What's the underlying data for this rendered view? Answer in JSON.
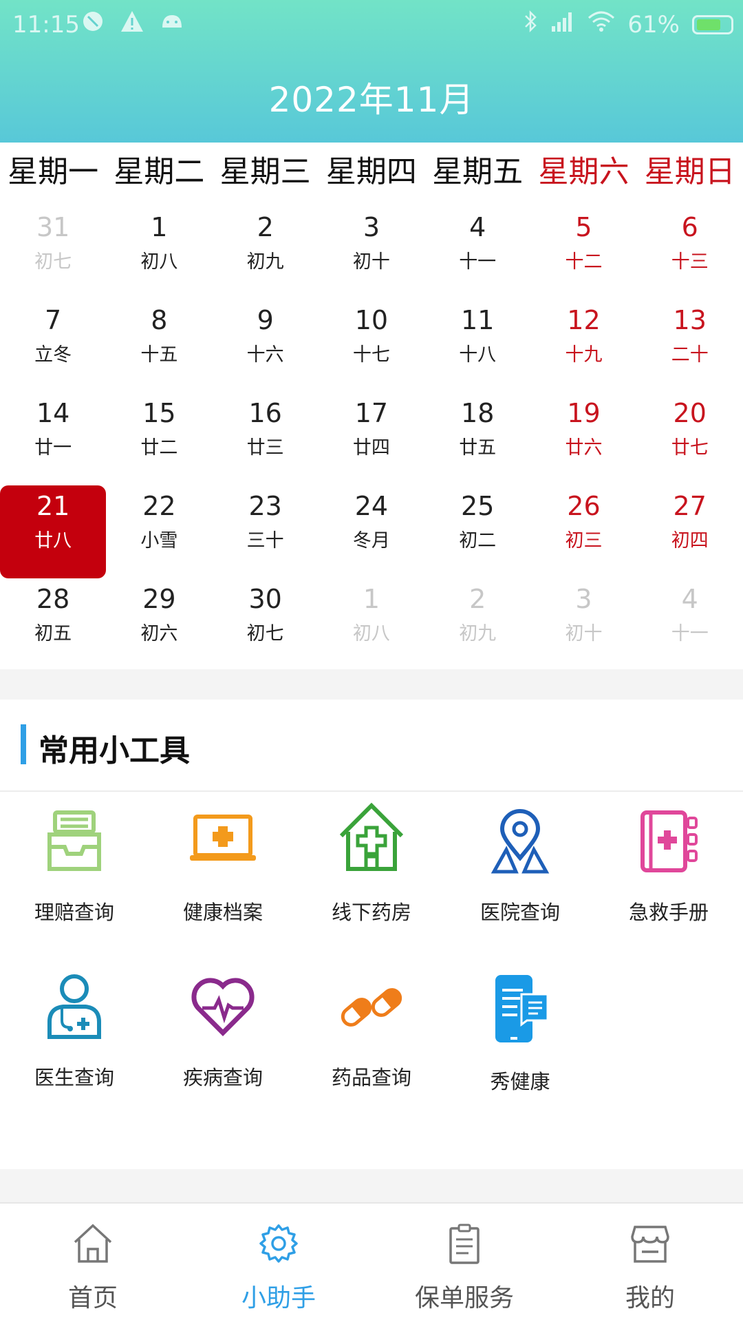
{
  "status_bar": {
    "time": "11:15",
    "battery": "61%",
    "icons": [
      "alarm-icon",
      "warning-icon",
      "android-icon",
      "bluetooth-icon",
      "signal-icon",
      "wifi-icon",
      "battery-icon"
    ]
  },
  "header": {
    "title": "2022年11月"
  },
  "weekdays": [
    "星期一",
    "星期二",
    "星期三",
    "星期四",
    "星期五",
    "星期六",
    "星期日"
  ],
  "calendar": {
    "days": [
      {
        "num": "31",
        "lunar": "初七",
        "type": "other"
      },
      {
        "num": "1",
        "lunar": "初八",
        "type": "normal"
      },
      {
        "num": "2",
        "lunar": "初九",
        "type": "normal"
      },
      {
        "num": "3",
        "lunar": "初十",
        "type": "normal"
      },
      {
        "num": "4",
        "lunar": "十一",
        "type": "normal"
      },
      {
        "num": "5",
        "lunar": "十二",
        "type": "weekend"
      },
      {
        "num": "6",
        "lunar": "十三",
        "type": "weekend"
      },
      {
        "num": "7",
        "lunar": "立冬",
        "type": "normal"
      },
      {
        "num": "8",
        "lunar": "十五",
        "type": "normal"
      },
      {
        "num": "9",
        "lunar": "十六",
        "type": "normal"
      },
      {
        "num": "10",
        "lunar": "十七",
        "type": "normal"
      },
      {
        "num": "11",
        "lunar": "十八",
        "type": "normal"
      },
      {
        "num": "12",
        "lunar": "十九",
        "type": "weekend"
      },
      {
        "num": "13",
        "lunar": "二十",
        "type": "weekend"
      },
      {
        "num": "14",
        "lunar": "廿一",
        "type": "normal"
      },
      {
        "num": "15",
        "lunar": "廿二",
        "type": "normal"
      },
      {
        "num": "16",
        "lunar": "廿三",
        "type": "normal"
      },
      {
        "num": "17",
        "lunar": "廿四",
        "type": "normal"
      },
      {
        "num": "18",
        "lunar": "廿五",
        "type": "normal"
      },
      {
        "num": "19",
        "lunar": "廿六",
        "type": "weekend"
      },
      {
        "num": "20",
        "lunar": "廿七",
        "type": "weekend"
      },
      {
        "num": "21",
        "lunar": "廿八",
        "type": "selected"
      },
      {
        "num": "22",
        "lunar": "小雪",
        "type": "normal"
      },
      {
        "num": "23",
        "lunar": "三十",
        "type": "normal"
      },
      {
        "num": "24",
        "lunar": "冬月",
        "type": "normal"
      },
      {
        "num": "25",
        "lunar": "初二",
        "type": "normal"
      },
      {
        "num": "26",
        "lunar": "初三",
        "type": "weekend"
      },
      {
        "num": "27",
        "lunar": "初四",
        "type": "weekend"
      },
      {
        "num": "28",
        "lunar": "初五",
        "type": "normal"
      },
      {
        "num": "29",
        "lunar": "初六",
        "type": "normal"
      },
      {
        "num": "30",
        "lunar": "初七",
        "type": "normal"
      },
      {
        "num": "1",
        "lunar": "初八",
        "type": "other"
      },
      {
        "num": "2",
        "lunar": "初九",
        "type": "other"
      },
      {
        "num": "3",
        "lunar": "初十",
        "type": "other"
      },
      {
        "num": "4",
        "lunar": "十一",
        "type": "other"
      }
    ]
  },
  "tools_section": {
    "title": "常用小工具",
    "tools": [
      {
        "label": "理赔查询",
        "icon": "inbox-tray-icon"
      },
      {
        "label": "健康档案",
        "icon": "medical-laptop-icon"
      },
      {
        "label": "线下药房",
        "icon": "pharmacy-house-icon"
      },
      {
        "label": "医院查询",
        "icon": "location-pin-icon"
      },
      {
        "label": "急救手册",
        "icon": "first-aid-book-icon"
      },
      {
        "label": "医生查询",
        "icon": "doctor-icon"
      },
      {
        "label": "疾病查询",
        "icon": "heartbeat-icon"
      },
      {
        "label": "药品查询",
        "icon": "pills-icon"
      },
      {
        "label": "秀健康",
        "icon": "phone-document-icon"
      }
    ]
  },
  "bottom_nav": {
    "items": [
      {
        "label": "首页",
        "icon": "home-icon"
      },
      {
        "label": "小助手",
        "icon": "gear-icon",
        "active": true
      },
      {
        "label": "保单服务",
        "icon": "clipboard-icon"
      },
      {
        "label": "我的",
        "icon": "store-icon"
      }
    ]
  },
  "colors": {
    "header_gradient_top": "#72e3c7",
    "header_gradient_bottom": "#58c8d8",
    "weekend_red": "#c8141e",
    "selected_bg": "#c4000d",
    "accent_blue": "#2f9fe6"
  }
}
